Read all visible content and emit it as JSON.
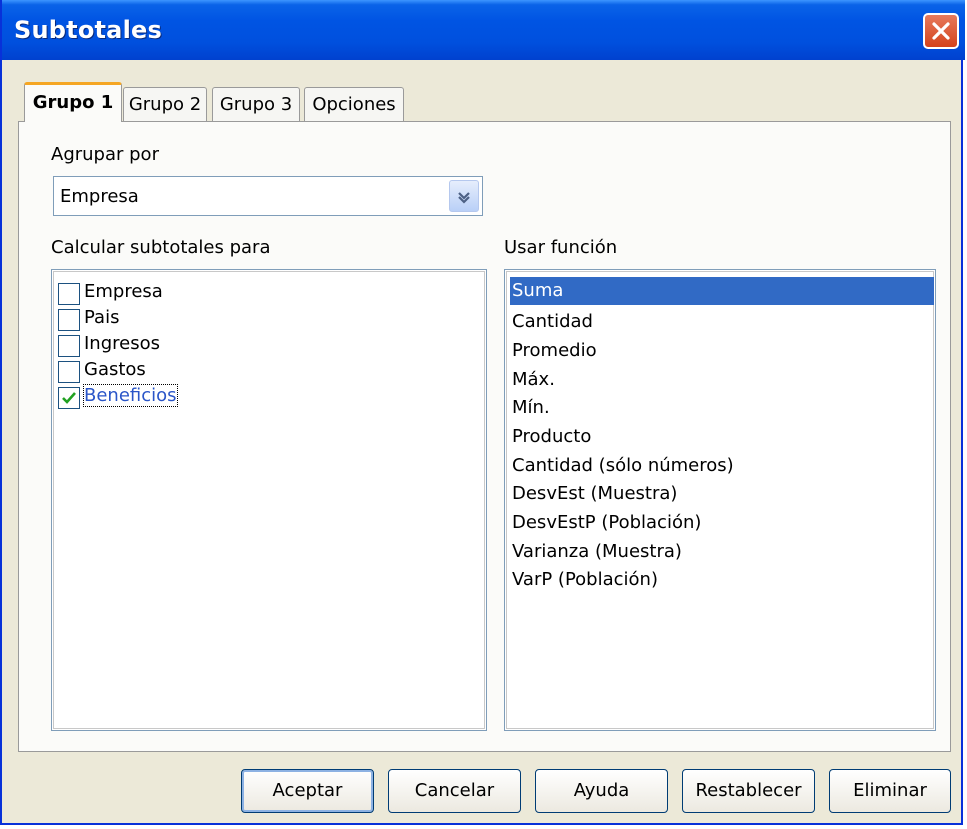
{
  "window": {
    "title": "Subtotales"
  },
  "tabs": [
    {
      "label": "Grupo 1",
      "active": true
    },
    {
      "label": "Grupo 2",
      "active": false
    },
    {
      "label": "Grupo 3",
      "active": false
    },
    {
      "label": "Opciones",
      "active": false
    }
  ],
  "group_by": {
    "label": "Agrupar por",
    "value": "Empresa"
  },
  "subtotals": {
    "label": "Calcular subtotales para",
    "items": [
      {
        "label": "Empresa",
        "checked": false
      },
      {
        "label": "Pais",
        "checked": false
      },
      {
        "label": "Ingresos",
        "checked": false
      },
      {
        "label": "Gastos",
        "checked": false
      },
      {
        "label": "Beneficios",
        "checked": true
      }
    ]
  },
  "function": {
    "label": "Usar función",
    "selected": "Suma",
    "items": [
      "Suma",
      "Cantidad",
      "Promedio",
      "Máx.",
      "Mín.",
      "Producto",
      "Cantidad (sólo números)",
      "DesvEst (Muestra)",
      "DesvEstP (Población)",
      "Varianza (Muestra)",
      "VarP (Población)"
    ]
  },
  "buttons": {
    "ok": "Aceptar",
    "cancel": "Cancelar",
    "help": "Ayuda",
    "reset": "Restablecer",
    "delete": "Eliminar"
  },
  "colors": {
    "titlebar": "#0054e3",
    "selection": "#316ac5",
    "active_tab_accent": "#f5a623",
    "close_button": "#d4431c"
  },
  "icons": {
    "close": "close-icon",
    "dropdown": "chevron-down-icon",
    "check": "check-icon"
  }
}
